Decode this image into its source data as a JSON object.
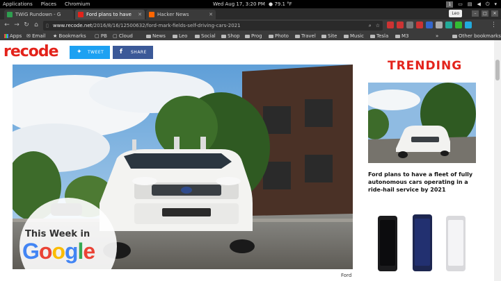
{
  "topbar": {
    "menus": [
      "Applications",
      "Places",
      "Chromium"
    ],
    "clock": "Wed Aug 17,  3:20 PM",
    "weather": "79.1 °F",
    "workspace": "1"
  },
  "tabs": [
    {
      "label": "TWiG Rundown - G",
      "favicon_color": "#2e9e4f",
      "active": false
    },
    {
      "label": "Ford plans to have",
      "favicon_color": "#e3231b",
      "active": true
    },
    {
      "label": "Hacker News",
      "favicon_color": "#ff6600",
      "active": false
    }
  ],
  "user_badge": "Leo",
  "omnibox": {
    "host": "www.recode.net",
    "path": "/2016/8/16/12500632/ford-mark-fields-self-driving-cars-2021"
  },
  "extension_colors": [
    "#c33",
    "#c33",
    "#777",
    "#c33",
    "#36c",
    "#aaa",
    "#2a9",
    "#3b3",
    "#2ad"
  ],
  "bookmarks": [
    {
      "label": "Apps",
      "kind": "grid"
    },
    {
      "label": "Email",
      "kind": "link"
    },
    {
      "label": "Bookmarks",
      "kind": "star"
    },
    {
      "label": "PB",
      "kind": "page"
    },
    {
      "label": "Cloud",
      "kind": "page"
    },
    {
      "label": "News",
      "kind": "folder"
    },
    {
      "label": "Leo",
      "kind": "folder"
    },
    {
      "label": "Social",
      "kind": "folder"
    },
    {
      "label": "Shop",
      "kind": "folder"
    },
    {
      "label": "Prog",
      "kind": "folder"
    },
    {
      "label": "Photo",
      "kind": "folder"
    },
    {
      "label": "Travel",
      "kind": "folder"
    },
    {
      "label": "Site",
      "kind": "folder"
    },
    {
      "label": "Music",
      "kind": "folder"
    },
    {
      "label": "Tesla",
      "kind": "folder"
    },
    {
      "label": "M3",
      "kind": "folder"
    }
  ],
  "other_bookmarks": "Other bookmarks",
  "site": {
    "logo": "recode",
    "tweet_label": "TWEET",
    "share_label": "SHARE",
    "hero_caption": "Ford",
    "trending_label": "TRENDING",
    "trending_title": "Ford plans to have a fleet of fully autonomous cars operating in a ride-hail service by 2021",
    "overlay_line1": "This Week in",
    "overlay_line2": "Google"
  },
  "colors": {
    "brand_red": "#e3231b",
    "twitter_blue": "#1da1f2",
    "facebook_blue": "#3b5998"
  }
}
